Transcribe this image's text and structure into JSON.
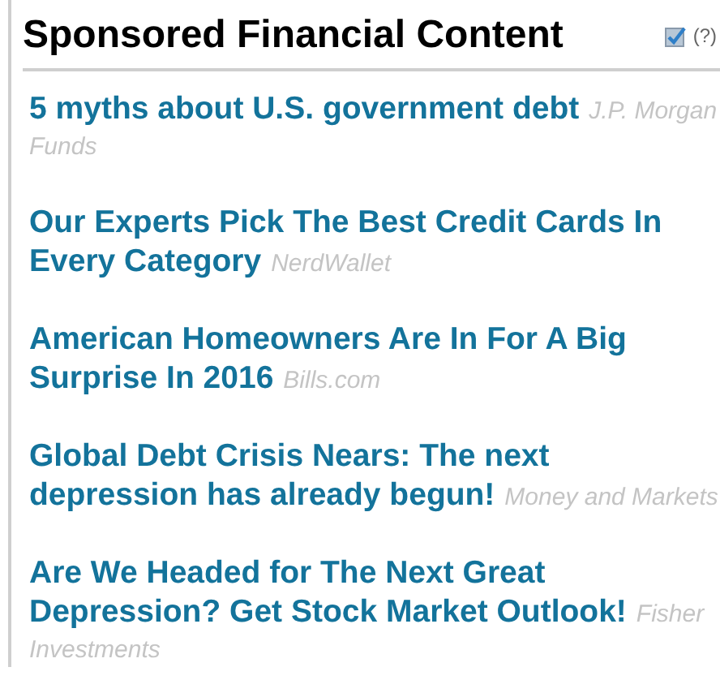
{
  "header": {
    "title": "Sponsored Financial Content",
    "checkbox": {
      "checked": true
    },
    "help": "(?)"
  },
  "items": [
    {
      "headline": "5 myths about U.S. government debt",
      "source": "J.P. Morgan Funds"
    },
    {
      "headline": "Our Experts Pick The Best Credit Cards In Every Category",
      "source": "NerdWallet"
    },
    {
      "headline": "American Homeowners Are In For A Big Surprise In 2016",
      "source": "Bills.com"
    },
    {
      "headline": "Global Debt Crisis Nears: The next depression has already begun!",
      "source": "Money and Markets"
    },
    {
      "headline": "Are We Headed for The Next Great Depression? Get Stock Market Outlook!",
      "source": "Fisher Investments"
    }
  ]
}
